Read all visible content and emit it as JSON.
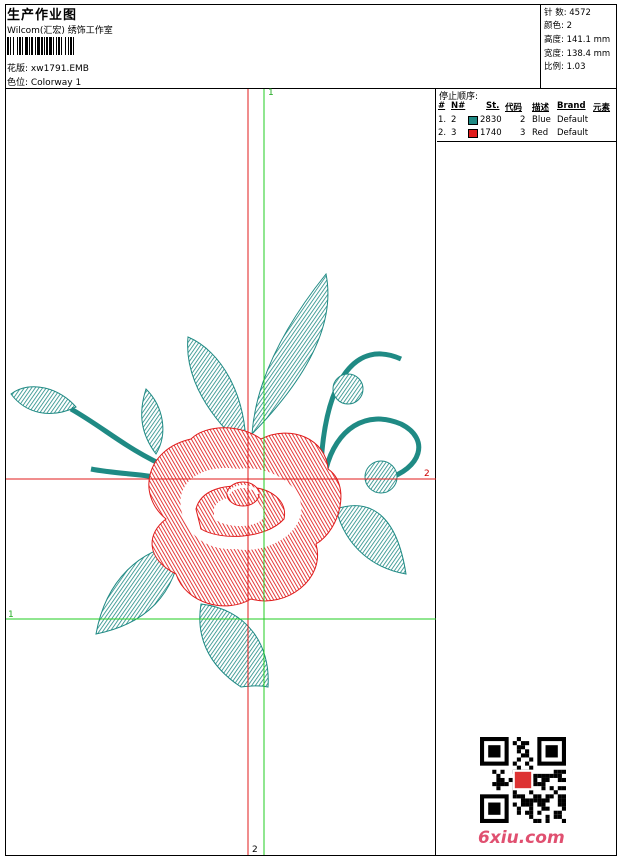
{
  "header": {
    "title": "生产作业图",
    "software": "Wilcom(汇宏) 绣饰工作室",
    "design_label": "花版: xw1791.EMB",
    "colorway_label": "色位: Colorway 1"
  },
  "stats": {
    "stitches": "针 数: 4572",
    "colors": "颜色: 2",
    "height": "高度: 141.1 mm",
    "width": "宽度: 138.4 mm",
    "scale": "比例: 1.03"
  },
  "stop_sequence": {
    "title": "停止顺序:",
    "columns": [
      "#",
      "N#",
      "St.",
      "代码",
      "描述",
      "Brand",
      "元素"
    ],
    "rows": [
      {
        "idx": "1.",
        "n": "2",
        "color": "#1f8a84",
        "stitches": "2830",
        "code": "2",
        "desc": "Blue",
        "brand": "Default"
      },
      {
        "idx": "2.",
        "n": "3",
        "color": "#e01b1b",
        "stitches": "1740",
        "code": "3",
        "desc": "Red",
        "brand": "Default"
      }
    ]
  },
  "markers": {
    "red_top": "1",
    "red_right": "2",
    "green_left": "1",
    "red_bottom": "2"
  },
  "colors": {
    "teal": "#1f8a84",
    "red": "#e01b1b",
    "guide_red": "#e01b1b",
    "guide_green": "#22cc22"
  },
  "watermark": "6xiu.com"
}
